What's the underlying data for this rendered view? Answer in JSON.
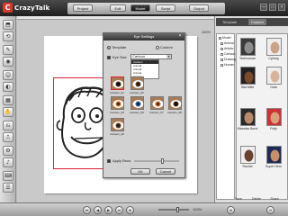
{
  "app": {
    "logo_text": "CrazyTalk",
    "logo_mark": "C"
  },
  "modes": [
    "Project",
    "Edit",
    "Model",
    "Script",
    "Output"
  ],
  "active_mode": "Model",
  "window_controls": [
    "—",
    "□",
    "×"
  ],
  "left_tools": [
    "⬒",
    "⟲",
    "✎",
    "◉",
    "☺",
    "◐",
    "▦",
    "✋",
    "⎌",
    "⎍",
    "⚙",
    "♪",
    "⌨",
    "☰"
  ],
  "canvas": {
    "zoom": "100%"
  },
  "dialog": {
    "title": "Eye Settings",
    "close": "×",
    "radio_template": "Template",
    "radio_custom": "Custom",
    "size_label": "Eye Size",
    "select_value": "Cartoon",
    "dropdown_options": [
      "Cartoon",
      "Animal",
      "Animal",
      "Animal",
      "Human"
    ],
    "eyes": [
      {
        "label": "Cartoon_01"
      },
      {
        "label": "Cartoon_02"
      },
      {
        "label": "Cartoon_05"
      },
      {
        "label": "Cartoon_06"
      },
      {
        "label": "Cartoon_07"
      },
      {
        "label": "Cartoon_08"
      },
      {
        "label": "Cartoon_09"
      }
    ],
    "apply_label": "Apply Brow",
    "ok_label": "OK",
    "cancel_label": "Cancel",
    "colors": {
      "eye_iris_dark": "#3a2512",
      "eye_iris_orange": "#c8641c",
      "eye_iris_blue": "#2f5b9a"
    }
  },
  "right_panel": {
    "tabs": [
      "Template",
      "Custom"
    ],
    "active_tab": "Custom",
    "tree": [
      "Model",
      "Animal",
      "Artistic",
      "Cartoon",
      "Drawing",
      "Human"
    ],
    "avatars": [
      {
        "label": "Technoman",
        "skin": "#6d6d6d"
      },
      {
        "label": "Cyborg",
        "skin": "#c9a488"
      },
      {
        "label": "Sad Mike",
        "skin": "#7a4a2a"
      },
      {
        "label": "Gaia",
        "skin": "#d8b59a"
      },
      {
        "label": "Maxwiss Bond",
        "skin": "#b98a6a"
      },
      {
        "label": "Polly",
        "skin": "#d9a080"
      },
      {
        "label": "Rachel",
        "skin": "#6b4230"
      },
      {
        "label": "Super Hero",
        "skin": "#c98e6a"
      }
    ],
    "footer": [
      "Save",
      "Delete",
      "Share"
    ]
  },
  "bottom_bar": {
    "buttons": [
      "⏮",
      "◀",
      "▶",
      "⏭",
      "⏺"
    ],
    "right_buttons": [
      "⊕",
      "⊖"
    ],
    "zoom_text": "100%"
  }
}
